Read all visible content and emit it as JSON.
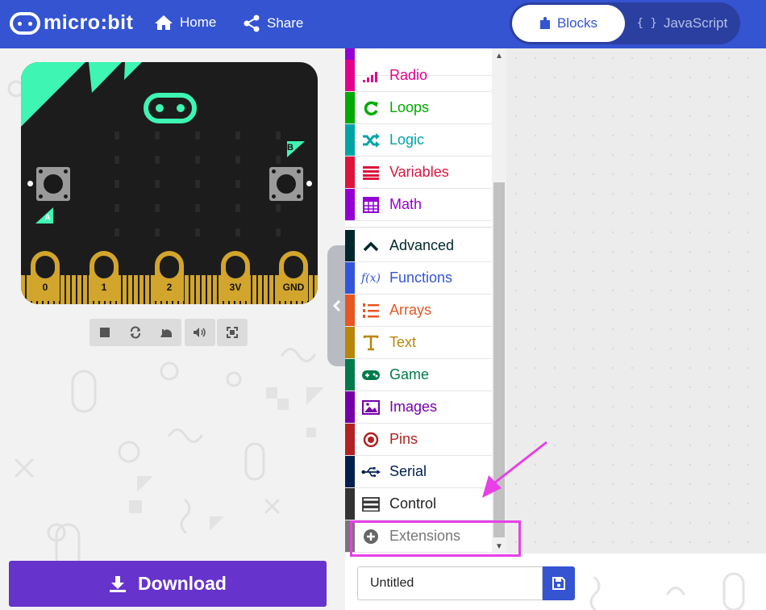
{
  "header": {
    "logo_text": "micro:bit",
    "nav": [
      {
        "label": "Home",
        "icon": "home-icon"
      },
      {
        "label": "Share",
        "icon": "share-icon"
      }
    ],
    "editor_toggle": {
      "blocks_label": "Blocks",
      "javascript_label": "JavaScript",
      "active": "Blocks"
    },
    "colors": {
      "header_bg": "#3454d1",
      "toggle_active_text": "#3454d1"
    }
  },
  "simulator": {
    "button_a_label": "A",
    "button_b_label": "B",
    "pins": [
      "0",
      "1",
      "2",
      "3V",
      "GND"
    ],
    "controls": [
      {
        "name": "stop",
        "icon": "stop-icon"
      },
      {
        "name": "restart",
        "icon": "restart-icon"
      },
      {
        "name": "slow-mo",
        "icon": "snail-icon"
      },
      {
        "name": "mute",
        "icon": "speaker-icon"
      },
      {
        "name": "fullscreen",
        "icon": "fullscreen-icon"
      }
    ]
  },
  "download": {
    "label": "Download",
    "icon": "download-icon",
    "color": "#6633cc"
  },
  "toolbox": {
    "categories": [
      {
        "label": "Radio",
        "color": "#e3008c",
        "icon": "signal-bars-icon"
      },
      {
        "label": "Loops",
        "color": "#00aa00",
        "icon": "loop-arrow-icon"
      },
      {
        "label": "Logic",
        "color": "#00a4a6",
        "icon": "shuffle-icon"
      },
      {
        "label": "Variables",
        "color": "#dc143c",
        "icon": "list-lines-icon"
      },
      {
        "label": "Math",
        "color": "#9400d3",
        "icon": "calculator-icon"
      }
    ],
    "advanced_categories": [
      {
        "label": "Advanced",
        "color": "#00272b",
        "icon": "chevron-up-icon"
      },
      {
        "label": "Functions",
        "color": "#3455db",
        "icon": "function-icon"
      },
      {
        "label": "Arrays",
        "color": "#e65722",
        "icon": "numbered-list-icon"
      },
      {
        "label": "Text",
        "color": "#b8860b",
        "icon": "text-t-icon"
      },
      {
        "label": "Game",
        "color": "#007a4b",
        "icon": "gamepad-icon"
      },
      {
        "label": "Images",
        "color": "#7600a8",
        "icon": "image-icon"
      },
      {
        "label": "Pins",
        "color": "#b22222",
        "icon": "target-icon"
      },
      {
        "label": "Serial",
        "color": "#002050",
        "icon": "usb-icon"
      },
      {
        "label": "Control",
        "color": "#333333",
        "icon": "server-icon"
      },
      {
        "label": "Extensions",
        "color": "#777777",
        "icon": "plus-circle-icon"
      }
    ]
  },
  "project": {
    "name_value": "Untitled",
    "save_icon": "save-icon"
  },
  "annotation": {
    "highlight_color": "#e740e7",
    "highlighted_item": "Extensions"
  }
}
